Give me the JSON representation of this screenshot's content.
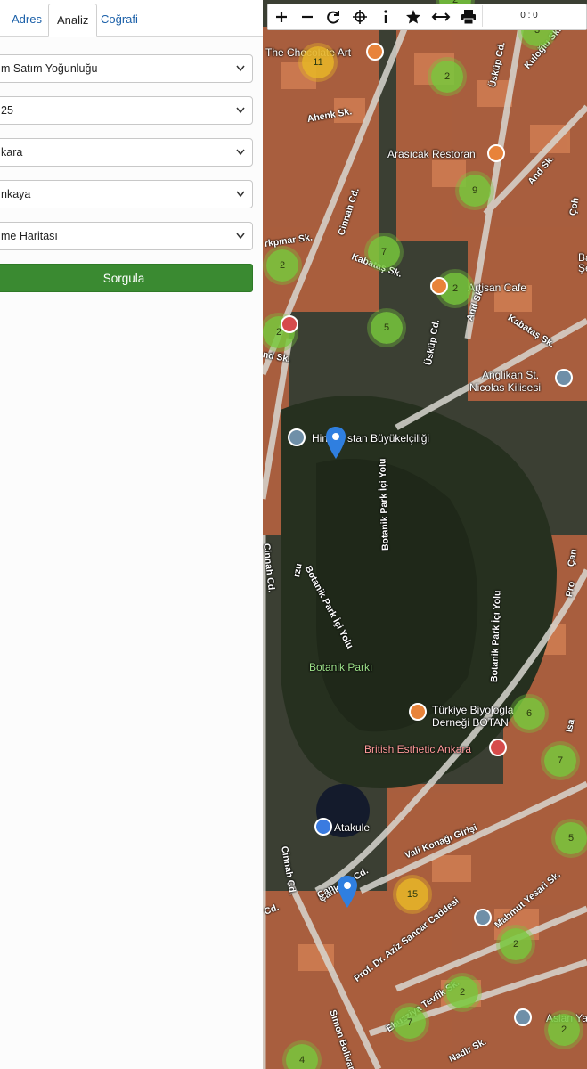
{
  "tabs": [
    "Adres",
    "Analiz",
    "Coğrafi"
  ],
  "form": {
    "selects": [
      "m Satım Yoğunluğu",
      "25",
      "kara",
      "nkaya",
      "me Haritası"
    ],
    "query_button": "Sorgula"
  },
  "toolbar": {
    "coordinate_readout": "0 : 0"
  },
  "map": {
    "places": [
      "The Chocolate Art",
      "Arasıcak Restoran",
      "Artisan Cafe",
      "Anglikan St.",
      "Nicolas Kilisesi",
      "Hin",
      "stan Büyükelçiliği",
      "Botanik Parkı",
      "Türkiye Biyologla",
      "Derneği BOTAN",
      "British Esthetic Ankara",
      "Atakule",
      "Aslan Yap",
      "Bak",
      "Şehitl"
    ],
    "streets": [
      "Ahenk Sk.",
      "Üsküp Cd.",
      "Kuloğlu Sk.",
      "And Sk.",
      "Cinnah Cd.",
      "Kabataş Sk.",
      "rkpınar Sk.",
      "Üsküp Cd.",
      "And Sk.",
      "Kabataş Sk.",
      "nd Sk.",
      "Botanik Park İçi Yolu",
      "Botanik Park İçi Yolu",
      "Botanik Park İçi Yolu",
      "Cinnah Cd.",
      "Cinnah Cd.",
      "Vali Konağı Girişi",
      "Prof. Dr. Aziz Sancar Caddesi",
      "Mahmut Yesari Sk.",
      "Ebuzziya Tevfik Sk.",
      "Simon Bolivar",
      "Nadir Sk.",
      "Çankaya Cd.",
      "Cd.",
      "Çan",
      "Pro",
      "Isa",
      "Çoh",
      "rzu",
      "Çan"
    ],
    "clusters": [
      "11",
      "2",
      "3",
      "9",
      "7",
      "2",
      "2",
      "5",
      "2",
      "6",
      "7",
      "5",
      "15",
      "2",
      "2",
      "7",
      "2",
      "4",
      "2"
    ]
  },
  "colors": {
    "accent": "#3a8a31",
    "tab_link": "#1a5fa8",
    "cluster_green": "#78c83c",
    "cluster_yellow": "#e6b428",
    "pin_blue": "#2f7fe0"
  }
}
